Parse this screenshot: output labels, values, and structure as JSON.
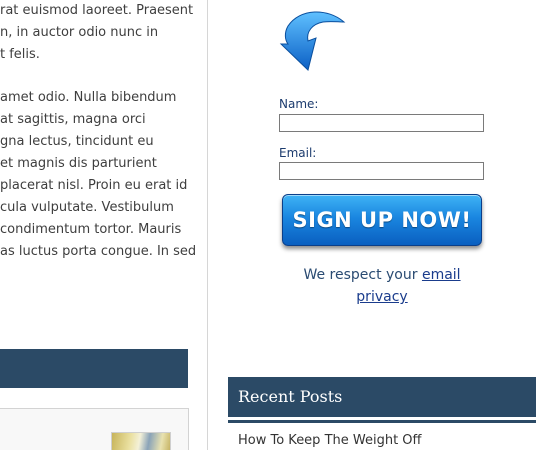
{
  "left": {
    "para1": [
      "rat euismod laoreet. Praesent",
      "n, in auctor odio nunc in",
      "t felis."
    ],
    "para2": [
      "amet odio. Nulla bibendum",
      "at sagittis, magna orci",
      "gna lectus, tincidunt eu",
      "et magnis dis parturient",
      "placerat nisl. Proin eu erat id",
      "cula vulputate. Vestibulum",
      "condimentum tortor. Mauris",
      "as luctus porta congue. In sed"
    ]
  },
  "signup": {
    "icon": "curved-arrow-down-icon",
    "name_label": "Name:",
    "email_label": "Email:",
    "name_value": "",
    "email_value": "",
    "button_label": "SIGN UP NOW!",
    "privacy_text": "We respect your",
    "privacy_link": "email privacy"
  },
  "recent_posts": {
    "title": "Recent Posts",
    "items": [
      "How To Keep The Weight Off"
    ]
  },
  "colors": {
    "bar": "#2b4a66",
    "button": "#1a86e0",
    "link": "#1a3c8c"
  }
}
